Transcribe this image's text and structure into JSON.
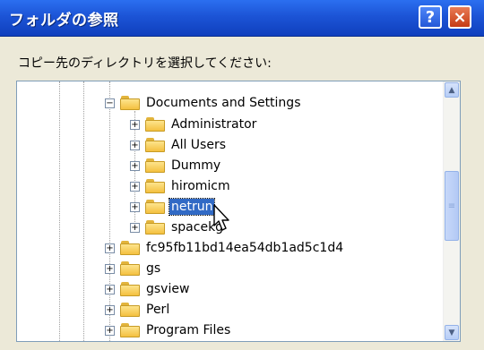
{
  "dialog": {
    "title": "フォルダの参照",
    "help_label": "?",
    "close_label": "×",
    "instruction": "コピー先のディレクトリを選択してください:"
  },
  "tree": {
    "items": [
      {
        "label": "Documents and Settings",
        "expander": "−",
        "selected": false
      },
      {
        "label": "Administrator",
        "expander": "+",
        "selected": false
      },
      {
        "label": "All Users",
        "expander": "+",
        "selected": false
      },
      {
        "label": "Dummy",
        "expander": "+",
        "selected": false
      },
      {
        "label": "hiromicm",
        "expander": "+",
        "selected": false
      },
      {
        "label": "netrun",
        "expander": "+",
        "selected": true
      },
      {
        "label": "spacekg",
        "expander": "+",
        "selected": false
      },
      {
        "label": "fc95fb11bd14ea54db1ad5c1d4",
        "expander": "+",
        "selected": false
      },
      {
        "label": "gs",
        "expander": "+",
        "selected": false
      },
      {
        "label": "gsview",
        "expander": "+",
        "selected": false
      },
      {
        "label": "Perl",
        "expander": "+",
        "selected": false
      },
      {
        "label": "Program Files",
        "expander": "+",
        "selected": false
      }
    ]
  },
  "scrollbar": {
    "up_icon": "▲",
    "down_icon": "▼",
    "grip_icon": "≡"
  },
  "colors": {
    "titlebar": "#1c54d6",
    "selection": "#316ac5",
    "close_button": "#c63b14"
  }
}
